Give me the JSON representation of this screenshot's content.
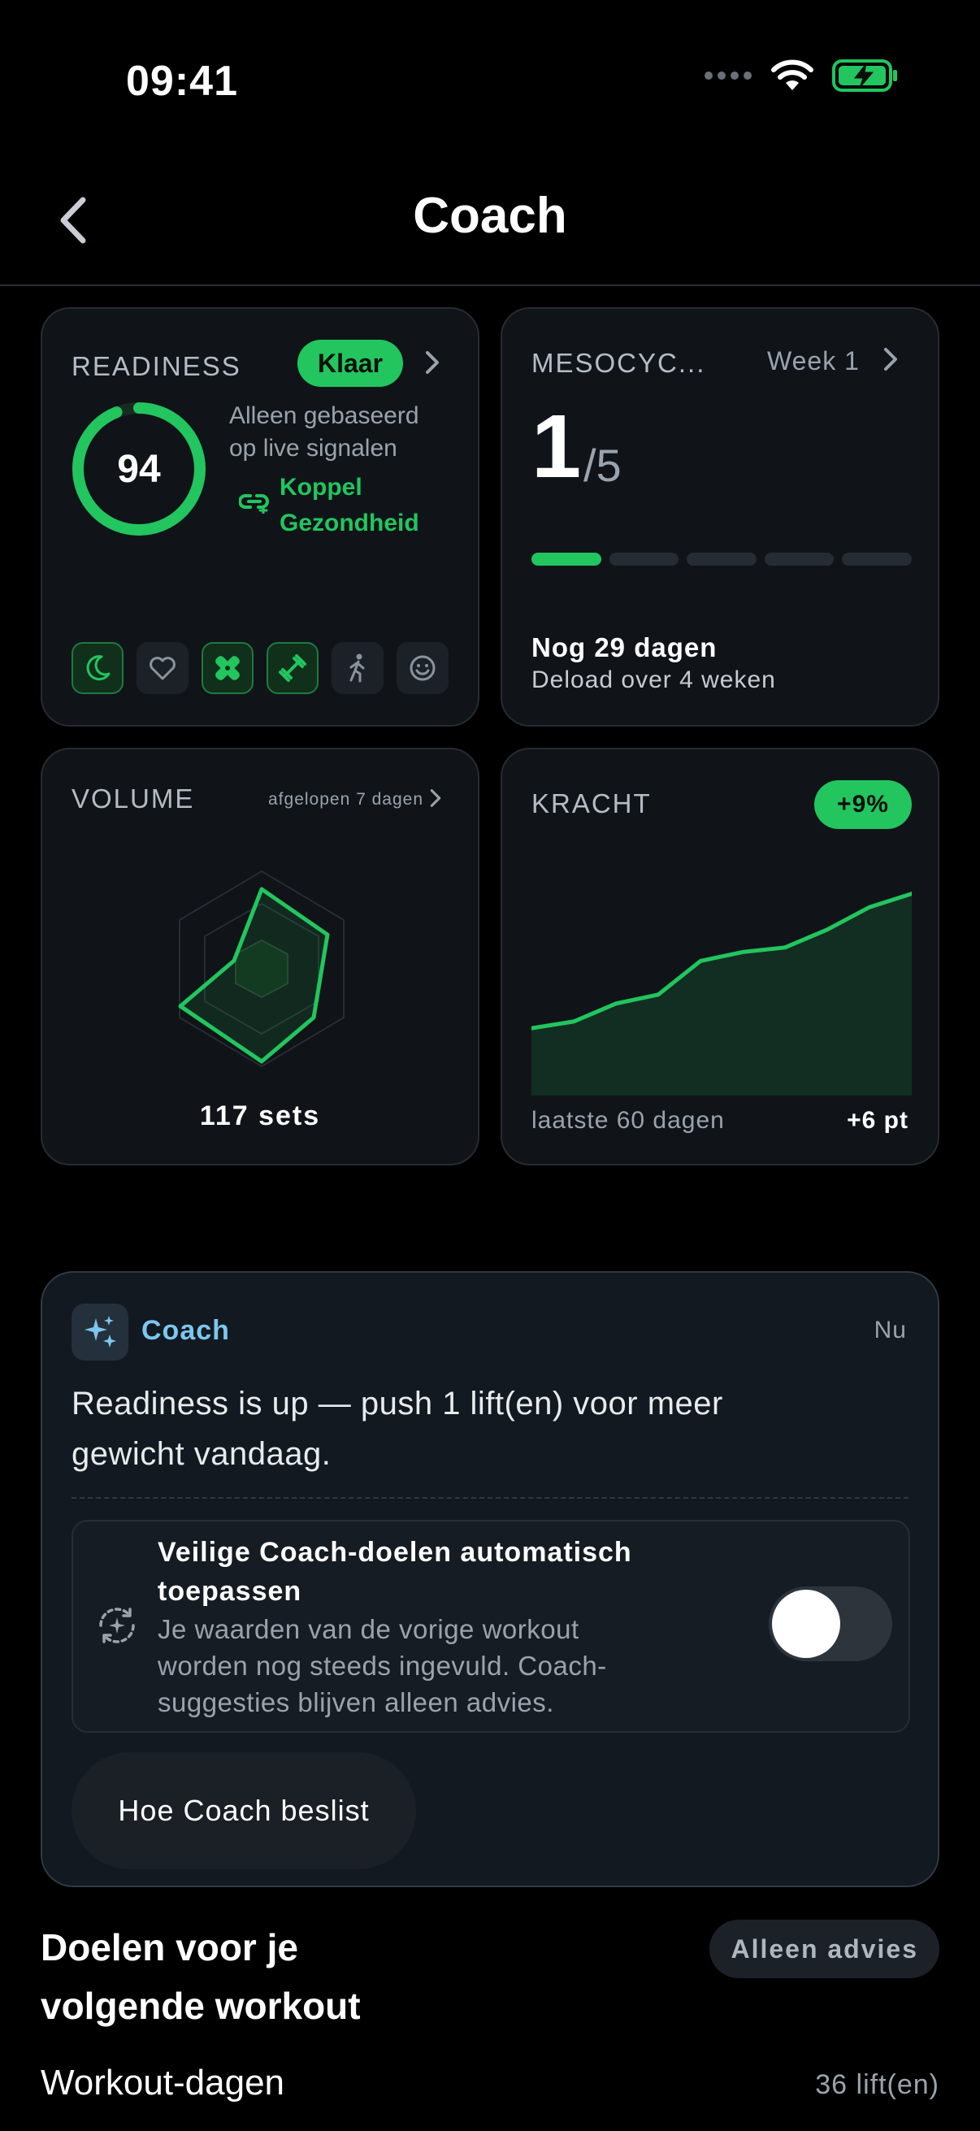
{
  "status_bar": {
    "time": "09:41"
  },
  "nav": {
    "title": "Coach"
  },
  "readiness": {
    "label": "READINESS",
    "badge": "Klaar",
    "score": "94",
    "score_fraction": 0.94,
    "note_line1": "Alleen gebaseerd",
    "note_line2": "op live signalen",
    "link_line1": "Koppel",
    "link_line2": "Gezondheid",
    "signals": [
      {
        "icon": "moon-icon",
        "active": true
      },
      {
        "icon": "heart-icon",
        "active": false
      },
      {
        "icon": "bandage-icon",
        "active": true
      },
      {
        "icon": "dumbbell-icon",
        "active": true
      },
      {
        "icon": "walking-icon",
        "active": false
      },
      {
        "icon": "smiley-icon",
        "active": false
      }
    ]
  },
  "mesocycle": {
    "label": "MESOCYC...",
    "week": "Week 1",
    "current": "1",
    "total": "/5",
    "progress_segments": 5,
    "completed_segments": 1,
    "days_left": "Nog 29 dagen",
    "deload": "Deload over 4 weken"
  },
  "volume": {
    "label": "VOLUME",
    "range": "afgelopen 7 dagen",
    "sets": "117 sets"
  },
  "kracht": {
    "label": "KRACHT",
    "badge": "+9%",
    "range": "laatste 60 dagen",
    "delta": "+6 pt"
  },
  "chart_data": {
    "type": "area",
    "x": [
      1,
      2,
      3,
      4,
      5,
      6,
      7,
      8,
      9,
      10
    ],
    "values": [
      0.3,
      0.33,
      0.41,
      0.45,
      0.6,
      0.64,
      0.66,
      0.74,
      0.84,
      0.9
    ],
    "color": "#22c55e"
  },
  "coach": {
    "title": "Coach",
    "time": "Nu",
    "message_line1": "Readiness is up — push 1 lift(en) voor meer",
    "message_line2": "gewicht vandaag.",
    "auto_title_line1": "Veilige Coach-doelen automatisch",
    "auto_title_line2": "toepassen",
    "auto_desc_line1": "Je waarden van de vorige workout",
    "auto_desc_line2": "worden nog steeds ingevuld. Coach-",
    "auto_desc_line3": "suggesties blijven alleen advies.",
    "toggle_on": false,
    "how_button": "Hoe Coach beslist"
  },
  "goals": {
    "title_line1": "Doelen voor je",
    "title_line2": "volgende workout",
    "badge": "Alleen advies",
    "row_label": "Workout-dagen",
    "row_value": "36 lift(en)"
  },
  "colors": {
    "accent": "#22c55e",
    "coach_blue": "#7cc6f0"
  }
}
